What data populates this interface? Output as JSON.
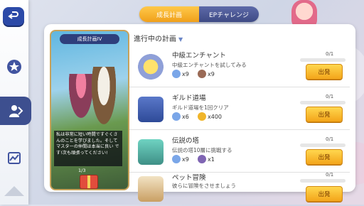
{
  "tabs": [
    "成長計画",
    "EPチャレンジ"
  ],
  "card": {
    "title": "成長計画IV",
    "story": "私は非常に短い時間ですぐくさんのことを学びました。そして マスターの仲間は本当に良い です!次も頑張ってください!",
    "page": "1/3"
  },
  "list": {
    "title": "進行中の計画",
    "rows": [
      {
        "title": "中級エンチャント",
        "desc": "中級エンチャントを試してみる",
        "progress_text": "0/1",
        "progress": 0,
        "button": "出発",
        "rewards": [
          {
            "icon": "snowflake-crystal-icon",
            "qty": "x9",
            "color": "#7aa6e8"
          },
          {
            "icon": "badge-medal-icon",
            "qty": "x9",
            "color": "#9a6a56"
          }
        ]
      },
      {
        "title": "ギルド道場",
        "desc": "ギルド道場を1回クリア",
        "progress_text": "0/1",
        "progress": 0,
        "button": "出発",
        "rewards": [
          {
            "icon": "snowflake-crystal-icon",
            "qty": "x6",
            "color": "#7aa6e8"
          },
          {
            "icon": "gold-coins-icon",
            "qty": "x400",
            "color": "#f0b52a"
          }
        ]
      },
      {
        "title": "伝説の塔",
        "desc": "伝説の塔10層に挑戦する",
        "progress_text": "0/1",
        "progress": 0,
        "button": "出発",
        "rewards": [
          {
            "icon": "snowflake-crystal-icon",
            "qty": "x9",
            "color": "#7aa6e8"
          },
          {
            "icon": "violet-medal-icon",
            "qty": "x1",
            "color": "#7f65b3"
          }
        ]
      },
      {
        "title": "ペット冒険",
        "desc": "彼らに冒険をさせましょう",
        "progress_text": "0/1",
        "progress": 0,
        "button": "出発",
        "rewards": []
      }
    ]
  }
}
